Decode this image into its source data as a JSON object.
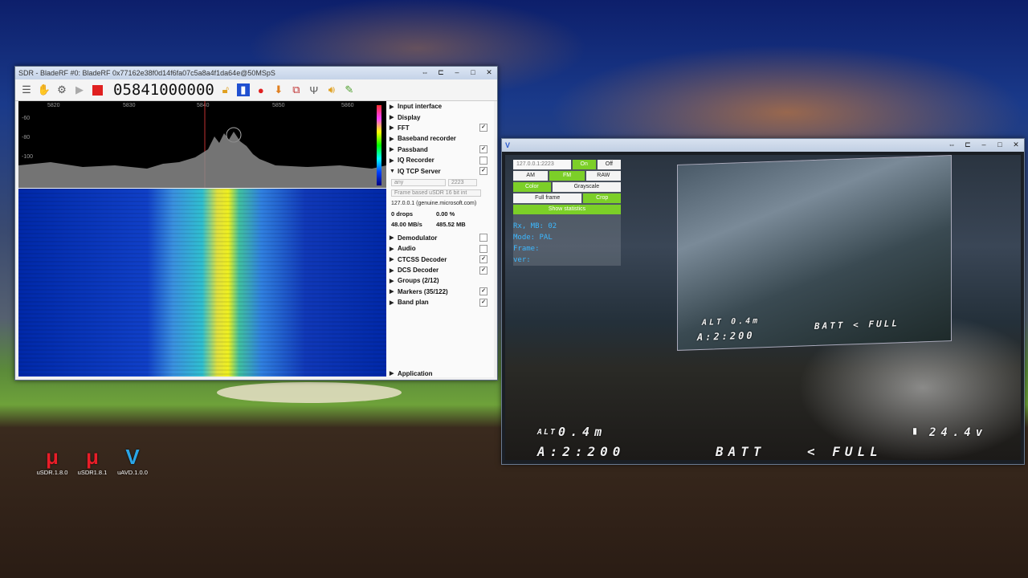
{
  "sdr_window": {
    "title": "SDR - BladeRF #0: BladeRF 0x77162e38f0d14f6fa07c5a8a4f1da64e@50MSpS",
    "frequency": "05841000000",
    "spectrum": {
      "scale_labels": [
        "5820",
        "5830",
        "5840",
        "5850",
        "5860"
      ],
      "y_labels": [
        "-60",
        "-80",
        "-100"
      ]
    },
    "panel": {
      "items": [
        {
          "label": "Input interface",
          "checkbox": null
        },
        {
          "label": "Display",
          "checkbox": null
        },
        {
          "label": "FFT",
          "checkbox": "✓"
        },
        {
          "label": "Baseband recorder",
          "checkbox": null
        },
        {
          "label": "Passband",
          "checkbox": "✓"
        },
        {
          "label": "IQ Recorder",
          "checkbox": ""
        },
        {
          "label": "IQ TCP Server",
          "checkbox": "✓",
          "expanded": true
        }
      ],
      "iq_server": {
        "host_placeholder": "any",
        "port": "2223",
        "format": "Frame based uSDR 16 bit int",
        "client": "127.0.0.1 (genuine.microsoft.com)",
        "drops": "0 drops",
        "drop_pct": "0.00 %",
        "rate": "48.00 MB/s",
        "total": "485.52 MB"
      },
      "items_after": [
        {
          "label": "Demodulator",
          "checkbox": ""
        },
        {
          "label": "Audio",
          "checkbox": ""
        },
        {
          "label": "CTCSS Decoder",
          "checkbox": "✓"
        },
        {
          "label": "DCS Decoder",
          "checkbox": "✓"
        },
        {
          "label": "Groups (2/12)",
          "checkbox": null
        },
        {
          "label": "Markers (35/122)",
          "checkbox": "✓"
        },
        {
          "label": "Band plan",
          "checkbox": "✓"
        }
      ],
      "application": "Application"
    }
  },
  "video_window": {
    "controls": {
      "address": "127.0.0.1:2223",
      "on": "On",
      "off": "Off",
      "am": "AM",
      "fm": "FM",
      "raw": "RAW",
      "color": "Color",
      "grayscale": "Grayscale",
      "full_frame": "Full frame",
      "crop": "Crop",
      "show_statistics": "Show statistics"
    },
    "stats": {
      "rx": "Rx, MB:",
      "rx_val": "02",
      "mode": "Mode:",
      "mode_val": "PAL",
      "frame": "Frame:",
      "ver": "ver:"
    },
    "osd": {
      "alt_small": "ALT 0.4m",
      "a_small": "A:2:200",
      "batt_small": "BATT < FULL",
      "alt": "ALT",
      "alt_val": "0.4m",
      "a": "A:2:200",
      "batt": "BATT",
      "full": "< FULL",
      "voltage": "24.4v"
    }
  },
  "desktop_icons": [
    {
      "label": "uSDR.1.8.0",
      "color": "#e81e28"
    },
    {
      "label": "uSDR1.8.1",
      "color": "#e81e28"
    },
    {
      "label": "uAVD.1.0.0",
      "color": "#2aa6e8"
    }
  ]
}
